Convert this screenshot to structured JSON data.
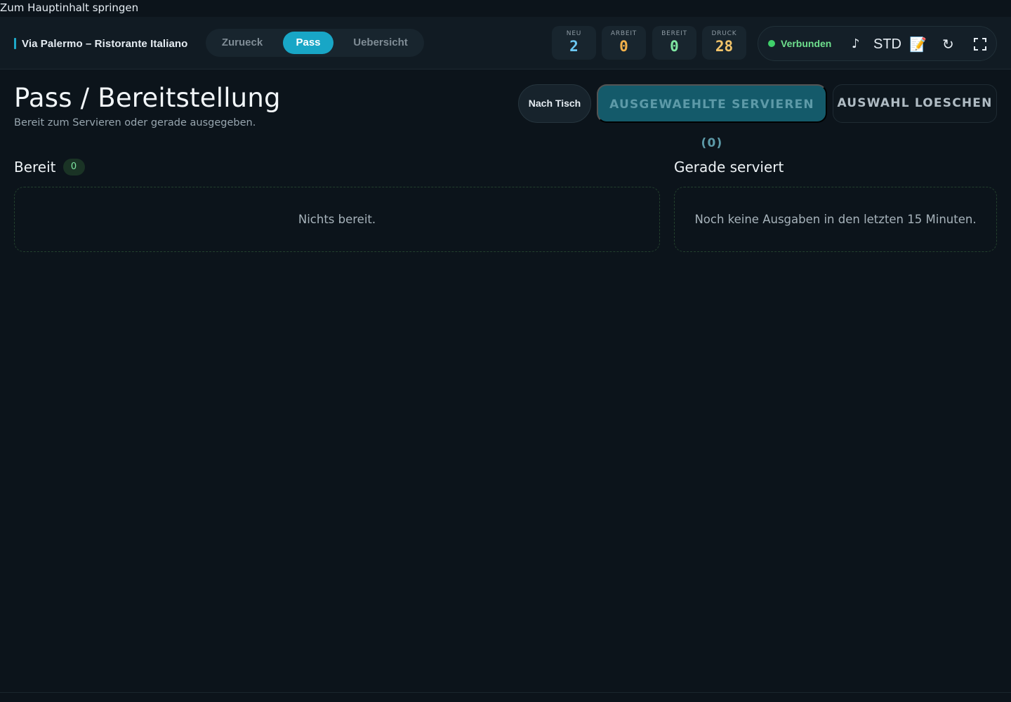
{
  "skip_link": "Zum Hauptinhalt springen",
  "brand": {
    "name": "Via Palermo – Ristorante Italiano",
    "accent": "#1ea8c8"
  },
  "nav": {
    "items": [
      {
        "label": "Zurueck",
        "active": false
      },
      {
        "label": "Pass",
        "active": true
      },
      {
        "label": "Uebersicht",
        "active": false
      }
    ]
  },
  "counters": [
    {
      "label": "NEU",
      "value": "2",
      "color": "#6cc8f2"
    },
    {
      "label": "ARBEIT",
      "value": "0",
      "color": "#f2b14a"
    },
    {
      "label": "BEREIT",
      "value": "0",
      "color": "#7fe6a2"
    },
    {
      "label": "DRUCK",
      "value": "28",
      "color": "#f2c46a"
    }
  ],
  "status": {
    "connection": "Verbunden",
    "connection_color": "#3fd06a",
    "sound_icon": "♪",
    "mode": "STD",
    "notes_icon": "📝",
    "refresh_icon": "↻"
  },
  "header": {
    "title": "Pass / Bereitstellung",
    "subtitle": "Bereit zum Servieren oder gerade ausgegeben."
  },
  "actions": {
    "by_table": "Nach Tisch",
    "serve_selected": "AUSGEWAEHLTE SERVIEREN (0)",
    "clear_selection": "AUSWAHL LOESCHEN"
  },
  "ready": {
    "title": "Bereit",
    "count": "0",
    "empty": "Nichts bereit."
  },
  "served": {
    "title": "Gerade serviert",
    "empty": "Noch keine Ausgaben in den letzten 15 Minuten."
  }
}
